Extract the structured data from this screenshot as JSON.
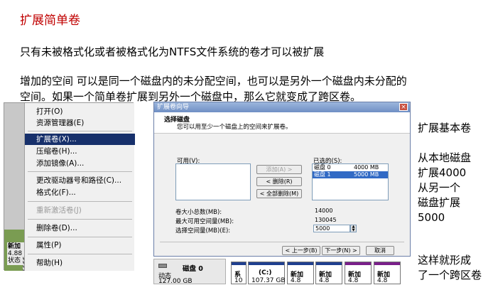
{
  "slide": {
    "title": "扩展简单卷",
    "line1": "只有未被格式化或者被格式化为NTFS文件系统的卷才可以被扩展",
    "line2": "增加的空间   可以是同一个磁盘内的未分配空间，也可以是另外一个磁盘内未分配的",
    "line3": "空间。如果一个简单卷扩展到另外一个磁盘中，那么它就变成了跨区卷。",
    "side1": "扩展基本卷",
    "side2": [
      "从本地磁盘",
      "扩展4000",
      "从另一个",
      "磁盘扩展",
      "5000"
    ],
    "side3": [
      "这样就形成",
      "了一个跨区卷"
    ]
  },
  "context_menu": {
    "items": [
      {
        "label": "打开(O)",
        "state": "normal"
      },
      {
        "label": "资源管理器(E)",
        "state": "normal"
      },
      {
        "label": "扩展卷(X)...",
        "state": "highlight"
      },
      {
        "label": "压缩卷(H)...",
        "state": "normal"
      },
      {
        "label": "添加镜像(A)...",
        "state": "normal"
      },
      {
        "label": "更改驱动器号和路径(C)...",
        "state": "normal"
      },
      {
        "label": "格式化(F)...",
        "state": "normal"
      },
      {
        "label": "重新激活卷(J)",
        "state": "disabled"
      },
      {
        "label": "删除卷(D)...",
        "state": "normal"
      },
      {
        "label": "属性(P)",
        "state": "normal"
      },
      {
        "label": "帮助(H)",
        "state": "normal"
      }
    ],
    "disk_label": [
      "新加",
      "4.88",
      "状态"
    ]
  },
  "wizard": {
    "title": "扩展卷向导",
    "close": "×",
    "header_title": "选择磁盘",
    "header_sub": "您可以用至少一个磁盘上的空间来扩展卷。",
    "available_label": "可用(V):",
    "selected_label": "已选的(S):",
    "add_button": "添加(A) >",
    "remove_button": "< 删除(R)",
    "remove_all_button": "< 全部删除(M)",
    "selected_disks": [
      {
        "name": "磁盘 0",
        "size": "4000 MB",
        "selected": false
      },
      {
        "name": "磁盘 1",
        "size": "5000 MB",
        "selected": true
      }
    ],
    "total_label": "卷大小总数(MB):",
    "total_value": "14000",
    "max_label": "最大可用空间量(MB):",
    "max_value": "130045",
    "select_label": "选择空间量(MB)(E):",
    "select_value": "5000",
    "back_button": "< 上一步(B)",
    "next_button": "下一步(N) >",
    "cancel_button": "取消"
  },
  "disk_bar": {
    "name": "磁盘 0",
    "type": "动态",
    "size": "127.00 GB",
    "partitions": [
      {
        "l1": "系",
        "l2": "10",
        "bar": "#1f3f8f"
      },
      {
        "l1": "(C:)",
        "l2": "107.37 GB",
        "bar": "#1f3f8f"
      },
      {
        "l1": "新加",
        "l2": "4.8",
        "bar": "#1f3f8f"
      },
      {
        "l1": "新加",
        "l2": "4.8",
        "bar": "#1f3f8f"
      },
      {
        "l1": "新加",
        "l2": "4.8",
        "bar": "#7a1f8a"
      },
      {
        "l1": "新加",
        "l2": "4.8",
        "bar": "#7a1f8a"
      }
    ]
  }
}
